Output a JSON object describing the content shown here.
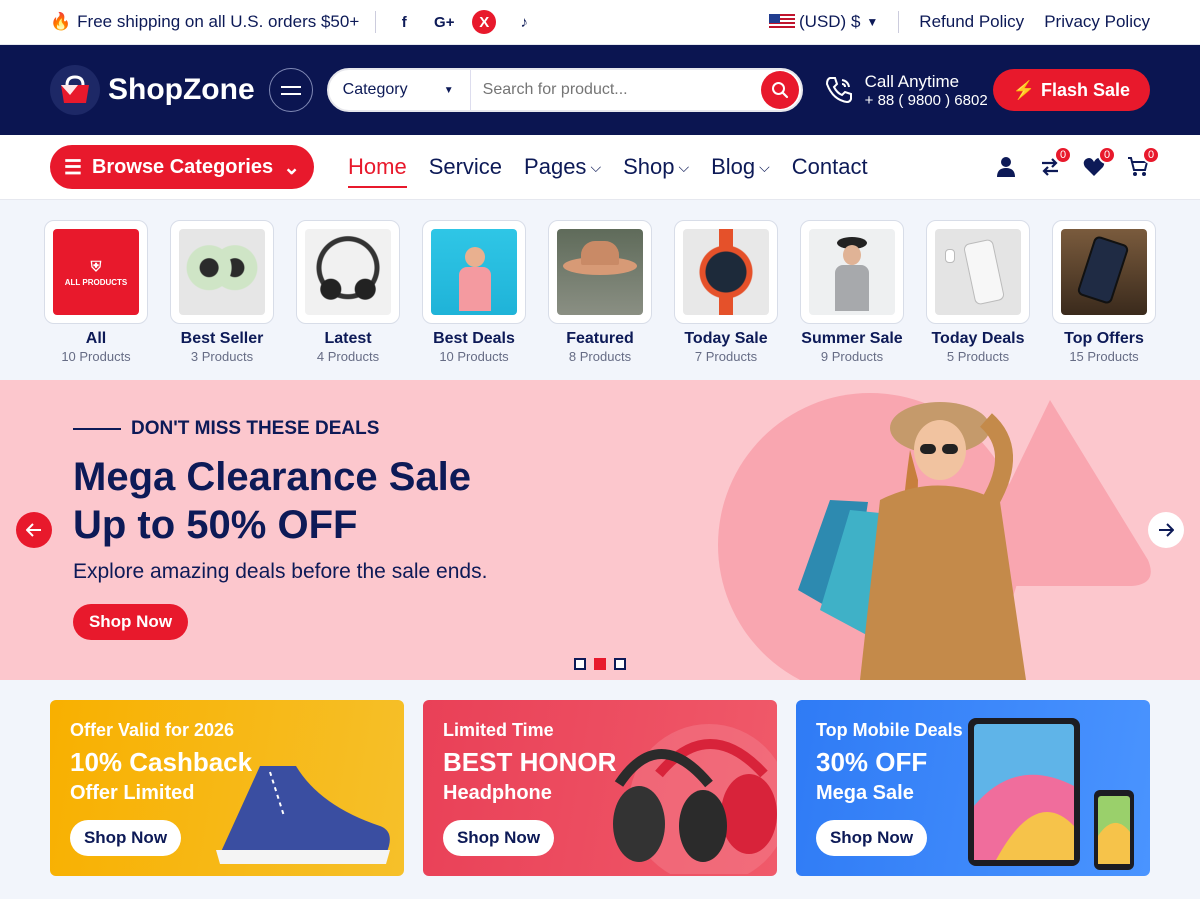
{
  "topbar": {
    "shipping": "Free shipping on all U.S. orders $50+",
    "social": [
      "facebook-icon",
      "google-plus-icon",
      "x-icon",
      "tiktok-icon"
    ],
    "currency": "(USD) $",
    "links": [
      "Refund Policy",
      "Privacy Policy"
    ]
  },
  "header": {
    "brand": "ShopZone",
    "category_label": "Category",
    "search_placeholder": "Search for product...",
    "call_label": "Call Anytime",
    "call_number": "+ 88 ( 9800 ) 6802",
    "flash_label": "Flash Sale"
  },
  "nav": {
    "browse_label": "Browse Categories",
    "items": [
      {
        "label": "Home",
        "active": true
      },
      {
        "label": "Service"
      },
      {
        "label": "Pages",
        "dropdown": true
      },
      {
        "label": "Shop",
        "dropdown": true
      },
      {
        "label": "Blog",
        "dropdown": true
      },
      {
        "label": "Contact"
      }
    ],
    "compare_count": "0",
    "wishlist_count": "0",
    "cart_count": "0"
  },
  "categories": [
    {
      "name": "All",
      "count": "10 Products",
      "badge": "ALL PRODUCTS"
    },
    {
      "name": "Best Seller",
      "count": "3 Products"
    },
    {
      "name": "Latest",
      "count": "4 Products"
    },
    {
      "name": "Best Deals",
      "count": "10 Products"
    },
    {
      "name": "Featured",
      "count": "8 Products"
    },
    {
      "name": "Today Sale",
      "count": "7 Products"
    },
    {
      "name": "Summer Sale",
      "count": "9 Products"
    },
    {
      "name": "Today Deals",
      "count": "5 Products"
    },
    {
      "name": "Top Offers",
      "count": "15 Products"
    }
  ],
  "hero": {
    "tag": "DON'T MISS THESE DEALS",
    "title_line1": "Mega Clearance Sale",
    "title_line2": "Up to 50% OFF",
    "subtitle": "Explore amazing deals before the sale ends.",
    "cta": "Shop Now"
  },
  "promos": [
    {
      "line1": "Offer Valid for 2026",
      "line2": "10% Cashback",
      "line3": "Offer Limited",
      "cta": "Shop Now"
    },
    {
      "line1": "Limited Time",
      "line2": "BEST HONOR",
      "line3": "Headphone",
      "cta": "Shop Now"
    },
    {
      "line1": "Top Mobile Deals",
      "line2": "30% OFF",
      "line3": "Mega Sale",
      "cta": "Shop Now"
    }
  ],
  "colors": {
    "navy": "#0b1551",
    "red": "#e8192c",
    "hero_bg": "#fcc7cd"
  }
}
